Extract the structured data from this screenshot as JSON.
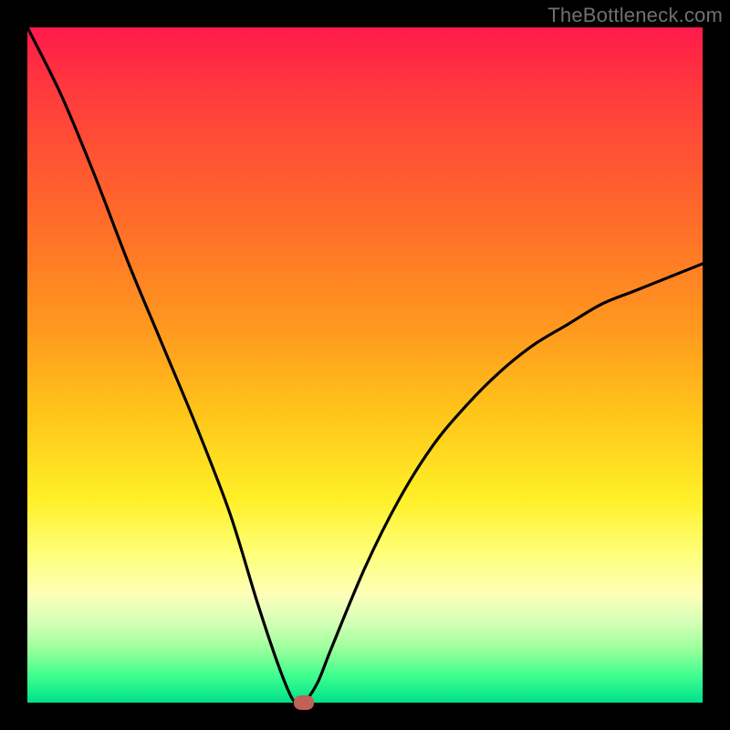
{
  "watermark": "TheBottleneck.com",
  "chart_data": {
    "type": "line",
    "title": "",
    "xlabel": "",
    "ylabel": "",
    "xlim": [
      0,
      100
    ],
    "ylim": [
      0,
      100
    ],
    "grid": false,
    "legend": false,
    "series": [
      {
        "name": "bottleneck-curve",
        "x": [
          0,
          5,
          10,
          15,
          20,
          25,
          30,
          34,
          37,
          39,
          40,
          41,
          43,
          45,
          50,
          55,
          60,
          65,
          70,
          75,
          80,
          85,
          90,
          95,
          100
        ],
        "values": [
          100,
          90,
          78,
          65,
          53,
          41,
          28,
          15,
          6,
          1,
          0,
          0,
          3,
          8,
          20,
          30,
          38,
          44,
          49,
          53,
          56,
          59,
          61,
          63,
          65
        ]
      }
    ],
    "marker": {
      "x": 41,
      "y": 0,
      "color": "#c06058"
    },
    "background_gradient": {
      "direction": "vertical",
      "stops": [
        {
          "pos": 0.0,
          "color": "#ff1a4a"
        },
        {
          "pos": 0.28,
          "color": "#ff6a2a"
        },
        {
          "pos": 0.58,
          "color": "#ffc81a"
        },
        {
          "pos": 0.78,
          "color": "#ffff7a"
        },
        {
          "pos": 0.92,
          "color": "#9cff9c"
        },
        {
          "pos": 1.0,
          "color": "#00e08a"
        }
      ]
    }
  }
}
